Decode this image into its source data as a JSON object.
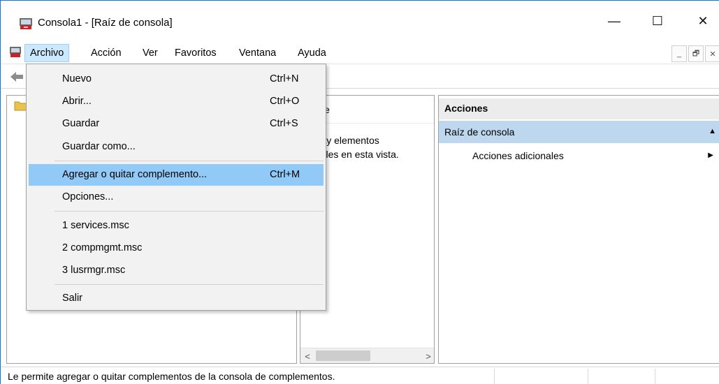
{
  "window": {
    "title": "Consola1 - [Raíz de consola]",
    "controls": {
      "minimize": "—",
      "maximize": "☐",
      "close": "✕"
    }
  },
  "menubar": {
    "items": [
      "Archivo",
      "Acción",
      "Ver",
      "Favoritos",
      "Ventana",
      "Ayuda"
    ],
    "active": "Archivo",
    "mdi_controls": [
      "_",
      "🗗",
      "✕"
    ]
  },
  "file_menu": {
    "items": [
      {
        "label": "Nuevo",
        "shortcut": "Ctrl+N"
      },
      {
        "label": "Abrir...",
        "shortcut": "Ctrl+O"
      },
      {
        "label": "Guardar",
        "shortcut": "Ctrl+S"
      },
      {
        "label": "Guardar como...",
        "shortcut": ""
      },
      {
        "label": "Agregar o quitar complemento...",
        "shortcut": "Ctrl+M",
        "highlighted": true
      },
      {
        "label": "Opciones...",
        "shortcut": ""
      },
      {
        "label": "1 services.msc",
        "shortcut": ""
      },
      {
        "label": "2 compmgmt.msc",
        "shortcut": ""
      },
      {
        "label": "3 lusrmgr.msc",
        "shortcut": ""
      },
      {
        "label": "Salir",
        "shortcut": ""
      }
    ]
  },
  "center_pane": {
    "column_header": "mbre",
    "empty_line1": "o hay elementos",
    "empty_line2": "onibles en esta vista.",
    "scroll_left": "<",
    "scroll_right": ">"
  },
  "actions_pane": {
    "header": "Acciones",
    "section": "Raíz de consola",
    "section_arrow": "▲",
    "item": "Acciones adicionales",
    "item_arrow": "▶"
  },
  "statusbar": {
    "text": "Le permite agregar o quitar complementos de la consola de complementos."
  },
  "colors": {
    "highlight": "#91c9f7",
    "menu_active": "#cce8ff",
    "section_bg": "#bcd7ee",
    "menu_bg": "#f2f2f2"
  }
}
